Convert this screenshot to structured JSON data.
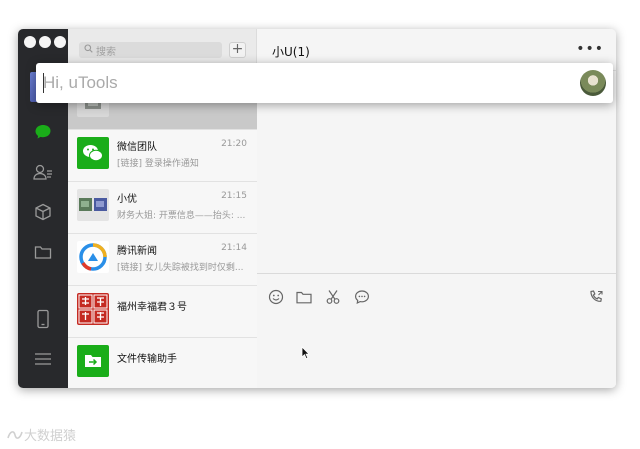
{
  "launcher": {
    "placeholder": "Hi, uTools"
  },
  "search": {
    "placeholder": "搜索"
  },
  "new_chat_label": "+",
  "chat": {
    "title": "小U(1)"
  },
  "conversations": [
    {
      "name": "",
      "time": "",
      "preview": ""
    },
    {
      "name": "微信团队",
      "time": "21:20",
      "preview": "[链接] 登录操作通知"
    },
    {
      "name": "小优",
      "time": "21:15",
      "preview": "财务大姐: 开票信息——抬头: ..."
    },
    {
      "name": "腾讯新闻",
      "time": "21:14",
      "preview": "[链接] 女儿失踪被找到时仅剩..."
    },
    {
      "name": "福州幸福君３号",
      "time": "",
      "preview": "",
      "avatar_text": "幸福西饼"
    },
    {
      "name": "文件传输助手",
      "time": "",
      "preview": ""
    }
  ],
  "colors": {
    "rail": "#28292c",
    "wechat_green": "#1aad19",
    "selected": "#c9c9c9"
  },
  "watermark": "大数据猿"
}
